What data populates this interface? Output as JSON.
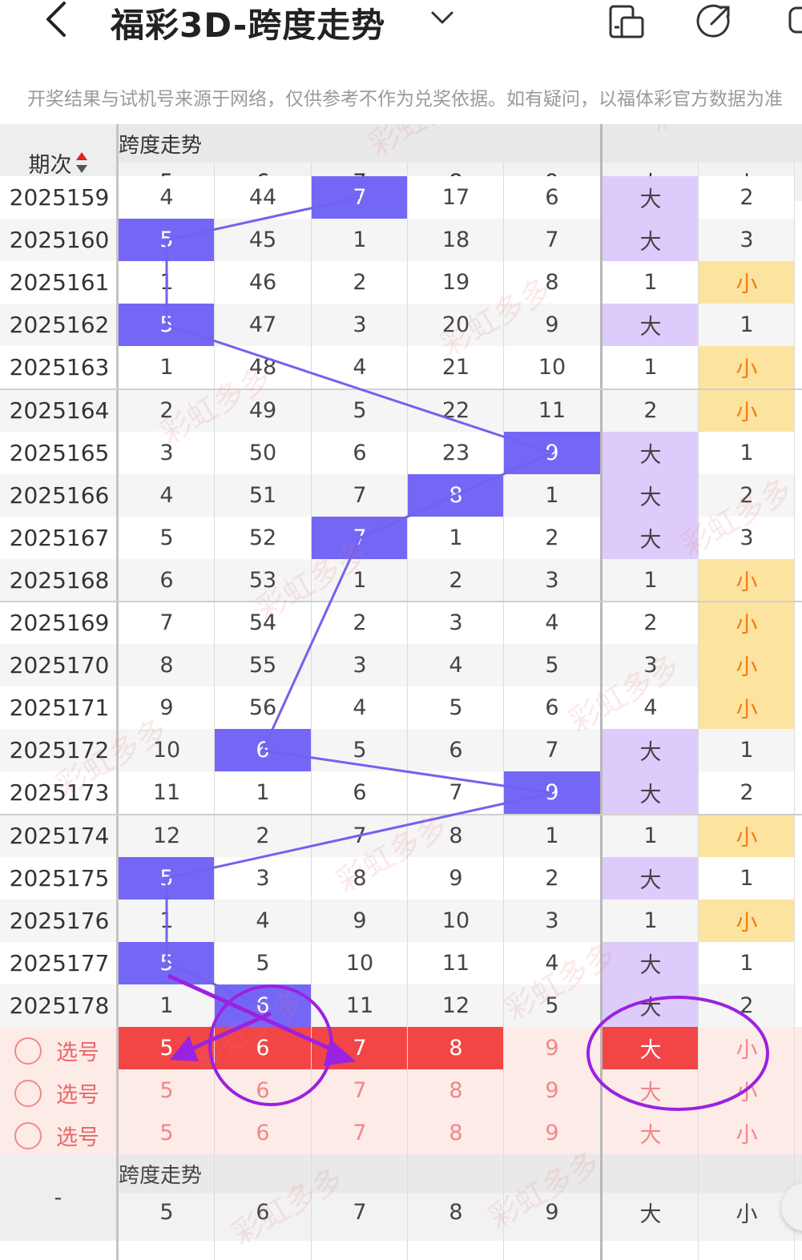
{
  "header": {
    "title": "福彩3D-跨度走势",
    "notice": "开奖结果与试机号来源于网络，仅供参考不作为兑奖依据。如有疑问，以福体彩官方数据为准"
  },
  "table": {
    "issue_header": "期次",
    "section_title": "跨度走势",
    "span_columns": [
      "5",
      "6",
      "7",
      "8",
      "9"
    ],
    "size_columns": [
      "大",
      "小"
    ],
    "rows": [
      {
        "issue": "2025159",
        "cells": [
          "4",
          "44",
          "7",
          "17",
          "6"
        ],
        "hit": 2,
        "size": [
          "大",
          "2"
        ],
        "sizeHit": 0
      },
      {
        "issue": "2025160",
        "cells": [
          "5",
          "45",
          "1",
          "18",
          "7"
        ],
        "hit": 0,
        "size": [
          "大",
          "3"
        ],
        "sizeHit": 0
      },
      {
        "issue": "2025161",
        "cells": [
          "1",
          "46",
          "2",
          "19",
          "8"
        ],
        "hit": -1,
        "size": [
          "1",
          "小"
        ],
        "sizeHit": 1
      },
      {
        "issue": "2025162",
        "cells": [
          "5",
          "47",
          "3",
          "20",
          "9"
        ],
        "hit": 0,
        "size": [
          "大",
          "1"
        ],
        "sizeHit": 0
      },
      {
        "issue": "2025163",
        "cells": [
          "1",
          "48",
          "4",
          "21",
          "10"
        ],
        "hit": -1,
        "size": [
          "1",
          "小"
        ],
        "sizeHit": 1
      },
      {
        "issue": "2025164",
        "cells": [
          "2",
          "49",
          "5",
          "22",
          "11"
        ],
        "hit": -1,
        "size": [
          "2",
          "小"
        ],
        "sizeHit": 1
      },
      {
        "issue": "2025165",
        "cells": [
          "3",
          "50",
          "6",
          "23",
          "9"
        ],
        "hit": 4,
        "size": [
          "大",
          "1"
        ],
        "sizeHit": 0
      },
      {
        "issue": "2025166",
        "cells": [
          "4",
          "51",
          "7",
          "8",
          "1"
        ],
        "hit": 3,
        "size": [
          "大",
          "2"
        ],
        "sizeHit": 0
      },
      {
        "issue": "2025167",
        "cells": [
          "5",
          "52",
          "7",
          "1",
          "2"
        ],
        "hit": 2,
        "size": [
          "大",
          "3"
        ],
        "sizeHit": 0
      },
      {
        "issue": "2025168",
        "cells": [
          "6",
          "53",
          "1",
          "2",
          "3"
        ],
        "hit": -1,
        "size": [
          "1",
          "小"
        ],
        "sizeHit": 1
      },
      {
        "issue": "2025169",
        "cells": [
          "7",
          "54",
          "2",
          "3",
          "4"
        ],
        "hit": -1,
        "size": [
          "2",
          "小"
        ],
        "sizeHit": 1
      },
      {
        "issue": "2025170",
        "cells": [
          "8",
          "55",
          "3",
          "4",
          "5"
        ],
        "hit": -1,
        "size": [
          "3",
          "小"
        ],
        "sizeHit": 1
      },
      {
        "issue": "2025171",
        "cells": [
          "9",
          "56",
          "4",
          "5",
          "6"
        ],
        "hit": -1,
        "size": [
          "4",
          "小"
        ],
        "sizeHit": 1
      },
      {
        "issue": "2025172",
        "cells": [
          "10",
          "6",
          "5",
          "6",
          "7"
        ],
        "hit": 1,
        "size": [
          "大",
          "1"
        ],
        "sizeHit": 0
      },
      {
        "issue": "2025173",
        "cells": [
          "11",
          "1",
          "6",
          "7",
          "9"
        ],
        "hit": 4,
        "size": [
          "大",
          "2"
        ],
        "sizeHit": 0
      },
      {
        "issue": "2025174",
        "cells": [
          "12",
          "2",
          "7",
          "8",
          "1"
        ],
        "hit": -1,
        "size": [
          "1",
          "小"
        ],
        "sizeHit": 1
      },
      {
        "issue": "2025175",
        "cells": [
          "5",
          "3",
          "8",
          "9",
          "2"
        ],
        "hit": 0,
        "size": [
          "大",
          "1"
        ],
        "sizeHit": 0
      },
      {
        "issue": "2025176",
        "cells": [
          "1",
          "4",
          "9",
          "10",
          "3"
        ],
        "hit": -1,
        "size": [
          "1",
          "小"
        ],
        "sizeHit": 1
      },
      {
        "issue": "2025177",
        "cells": [
          "5",
          "5",
          "10",
          "11",
          "4"
        ],
        "hit": 0,
        "size": [
          "大",
          "1"
        ],
        "sizeHit": 0
      },
      {
        "issue": "2025178",
        "cells": [
          "1",
          "6",
          "11",
          "12",
          "5"
        ],
        "hit": 1,
        "size": [
          "大",
          "2"
        ],
        "sizeHit": 0
      }
    ],
    "pick_label": "选号",
    "pick_rows": [
      {
        "cells": [
          "5",
          "6",
          "7",
          "8",
          "9"
        ],
        "size": [
          "大",
          "小"
        ],
        "selected": [
          0,
          1,
          2,
          3
        ],
        "sizeSelected": [
          0
        ]
      },
      {
        "cells": [
          "5",
          "6",
          "7",
          "8",
          "9"
        ],
        "size": [
          "大",
          "小"
        ],
        "selected": [],
        "sizeSelected": []
      },
      {
        "cells": [
          "5",
          "6",
          "7",
          "8",
          "9"
        ],
        "size": [
          "大",
          "小"
        ],
        "selected": [],
        "sizeSelected": []
      }
    ],
    "footer_issue": "-",
    "footer_section_title": "跨度走势",
    "watermark": "彩虹多多"
  },
  "colors": {
    "hit_blue": "#7467f6",
    "purple_bg": "#ddccfb",
    "yellow_bg": "#fde3a0",
    "small_text": "#f07d0f",
    "red_selected": "#f24646",
    "pick_bg": "#fdebe8",
    "annotation": "#9b22e0"
  }
}
